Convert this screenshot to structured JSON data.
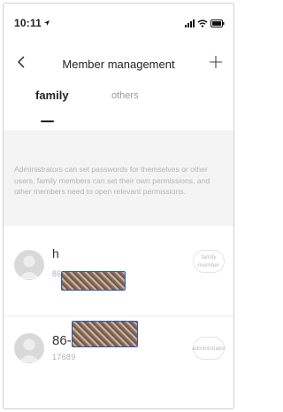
{
  "status_bar": {
    "time": "10:11",
    "icons": [
      "location-arrow-icon",
      "signal-icon",
      "wifi-icon",
      "battery-icon"
    ]
  },
  "header": {
    "title": "Member management",
    "back_icon": "chevron-left-icon",
    "add_icon": "plus-icon"
  },
  "tabs": [
    {
      "label": "family",
      "selected": true
    },
    {
      "label": "others",
      "selected": false
    }
  ],
  "info": {
    "text": "Administrators can set passwords for themselves or other users, family members can set their own permissions, and other members need to open relevant permissions."
  },
  "members": [
    {
      "name": "h",
      "phone": "86-1",
      "role": "family member",
      "avatar_icon": "default-avatar-icon"
    },
    {
      "name": "86-17",
      "phone": "17689",
      "role": "administrator",
      "avatar_icon": "default-avatar-icon"
    }
  ],
  "colors": {
    "background": "#ffffff",
    "info_background": "#f4f4f4",
    "muted_text": "#b4b4b4",
    "redaction_border": "#2f55b0"
  }
}
